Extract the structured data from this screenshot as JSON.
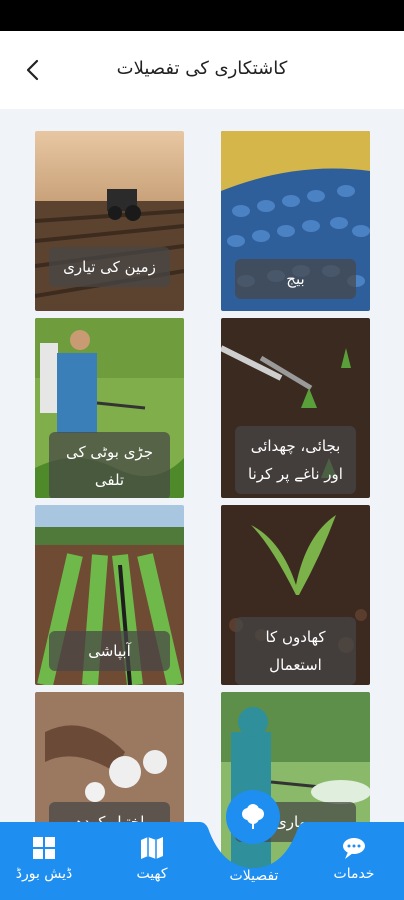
{
  "header": {
    "title": "کاشتکاری کی تفصیلات"
  },
  "cards": [
    {
      "label": "زمین کی تیاری"
    },
    {
      "label": "بیج"
    },
    {
      "label": "جڑی بوٹی کی تلفی"
    },
    {
      "label": "بجائی، چھدائی اور ناغے پر کرنا"
    },
    {
      "label": "آبپاشی"
    },
    {
      "label": "کھادوں کا استعمال"
    },
    {
      "label": "اختیار کردہ پانسداد"
    },
    {
      "label": "بیماری"
    }
  ],
  "nav": {
    "items": [
      {
        "label": "ڈیش بورڈ",
        "icon": "dashboard-icon"
      },
      {
        "label": "کھیت",
        "icon": "map-icon"
      },
      {
        "label": "تفصیلات",
        "icon": "cotton-icon"
      },
      {
        "label": "خدمات",
        "icon": "chat-icon"
      }
    ],
    "color": "#1e8ff0"
  }
}
